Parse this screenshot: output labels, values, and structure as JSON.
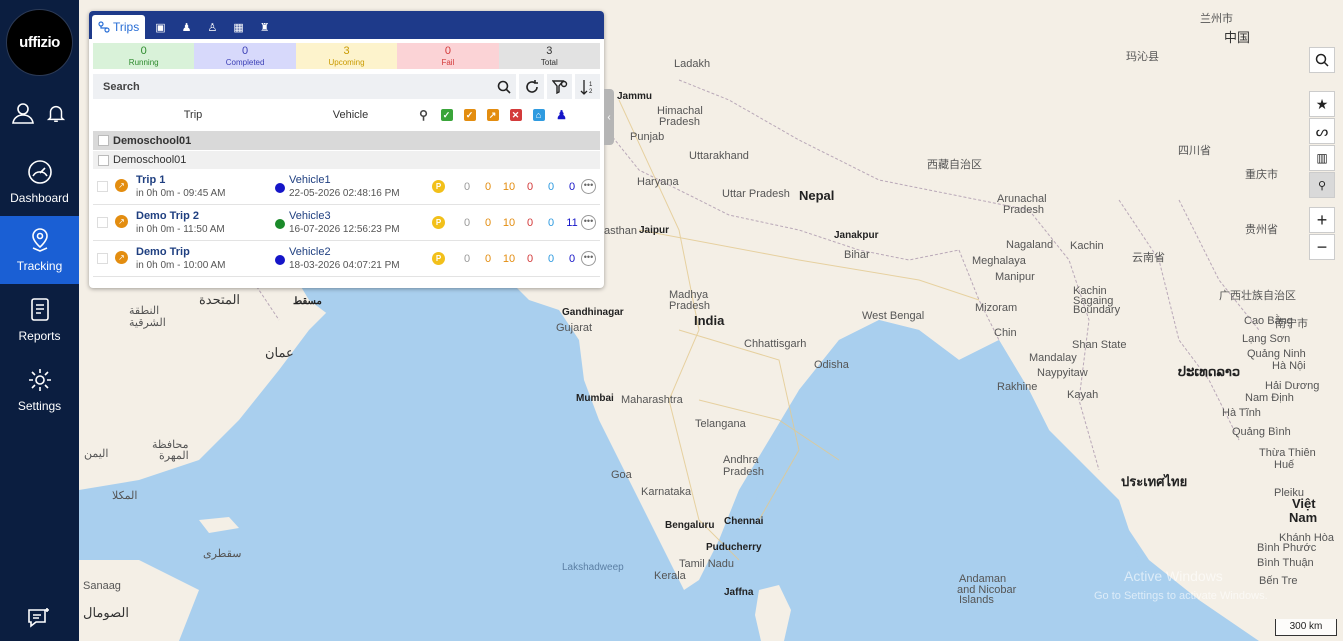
{
  "app": {
    "logo_text": "uffizio"
  },
  "sidebar": {
    "nav": [
      {
        "label": "Dashboard",
        "icon": "dashboard-gauge-icon",
        "active": false
      },
      {
        "label": "Tracking",
        "icon": "location-pin-icon",
        "active": true
      },
      {
        "label": "Reports",
        "icon": "reports-icon",
        "active": false
      },
      {
        "label": "Settings",
        "icon": "gear-icon",
        "active": false
      }
    ]
  },
  "panel": {
    "tabs": {
      "active_label": "Trips"
    },
    "stats": [
      {
        "value": "0",
        "label": "Running",
        "bg": "#d9f2d9",
        "color": "#2e8b2e"
      },
      {
        "value": "0",
        "label": "Completed",
        "bg": "#d7d9fb",
        "color": "#3b3fb5"
      },
      {
        "value": "3",
        "label": "Upcoming",
        "bg": "#fdf3cc",
        "color": "#c99a00"
      },
      {
        "value": "0",
        "label": "Fail",
        "bg": "#fbd3d6",
        "color": "#d33a3a"
      },
      {
        "value": "3",
        "label": "Total",
        "bg": "#e2e2e2",
        "color": "#333333"
      }
    ],
    "search": {
      "placeholder": "Search"
    },
    "columns": {
      "trip": "Trip",
      "vehicle": "Vehicle"
    },
    "groups": {
      "primary": "Demoschool01",
      "secondary": "Demoschool01"
    },
    "trips": [
      {
        "name": "Trip 1",
        "time": "in 0h 0m - 09:45 AM",
        "vehicle": "Vehicle1",
        "vehicle_time": "22-05-2026 02:48:16 PM",
        "vehicle_color": "#1515c8",
        "counts": [
          "0",
          "0",
          "10",
          "0",
          "0",
          "0"
        ]
      },
      {
        "name": "Demo Trip 2",
        "time": "in 0h 0m - 11:50 AM",
        "vehicle": "Vehicle3",
        "vehicle_time": "16-07-2026 12:56:23 PM",
        "vehicle_color": "#1a8a2a",
        "counts": [
          "0",
          "0",
          "10",
          "0",
          "0",
          "11"
        ]
      },
      {
        "name": "Demo Trip",
        "time": "in 0h 0m - 10:00 AM",
        "vehicle": "Vehicle2",
        "vehicle_time": "18-03-2026 04:07:21 PM",
        "vehicle_color": "#1515c8",
        "counts": [
          "0",
          "0",
          "10",
          "0",
          "0",
          "0"
        ]
      }
    ],
    "count_colors": [
      "#9a9a9a",
      "#e38d10",
      "#e38d10",
      "#d33a3a",
      "#2f9be0",
      "#1515c8"
    ]
  },
  "map": {
    "labels": [
      {
        "t": "Nepal",
        "c": "big"
      },
      {
        "t": "India",
        "c": "big"
      },
      {
        "t": "Jammu",
        "c": "city"
      },
      {
        "t": "Ladakh",
        "c": ""
      },
      {
        "t": "Himachal",
        "c": ""
      },
      {
        "t": "Pradesh",
        "c": ""
      },
      {
        "t": "Punjab",
        "c": ""
      },
      {
        "t": "Uttarakhand",
        "c": ""
      },
      {
        "t": "Haryana",
        "c": ""
      },
      {
        "t": "Uttar Pradesh",
        "c": ""
      },
      {
        "t": "Jaipur",
        "c": "city"
      },
      {
        "t": "asthan",
        "c": ""
      },
      {
        "t": "Janakpur",
        "c": "city"
      },
      {
        "t": "Bihar",
        "c": ""
      },
      {
        "t": "Madhya",
        "c": ""
      },
      {
        "t": "Pradesh",
        "c": ""
      },
      {
        "t": "Gandhinagar",
        "c": "city"
      },
      {
        "t": "Gujarat",
        "c": ""
      },
      {
        "t": "Chhattisgarh",
        "c": ""
      },
      {
        "t": "West Bengal",
        "c": ""
      },
      {
        "t": "Odisha",
        "c": ""
      },
      {
        "t": "Mumbai",
        "c": "city"
      },
      {
        "t": "Maharashtra",
        "c": ""
      },
      {
        "t": "Telangana",
        "c": ""
      },
      {
        "t": "Andhra",
        "c": ""
      },
      {
        "t": "Pradesh",
        "c": ""
      },
      {
        "t": "Goa",
        "c": ""
      },
      {
        "t": "Karnataka",
        "c": ""
      },
      {
        "t": "Bengaluru",
        "c": "city"
      },
      {
        "t": "Chennai",
        "c": "city"
      },
      {
        "t": "Puducherry",
        "c": "city"
      },
      {
        "t": "Tamil Nadu",
        "c": ""
      },
      {
        "t": "Kerala",
        "c": ""
      },
      {
        "t": "Lakshadweep",
        "c": ""
      },
      {
        "t": "Jaffna",
        "c": "city"
      },
      {
        "t": "Arunachal",
        "c": ""
      },
      {
        "t": "Pradesh",
        "c": ""
      },
      {
        "t": "Meghalaya",
        "c": ""
      },
      {
        "t": "Nagaland",
        "c": ""
      },
      {
        "t": "Manipur",
        "c": ""
      },
      {
        "t": "Kachin",
        "c": ""
      },
      {
        "t": "Mizoram",
        "c": ""
      },
      {
        "t": "Chin",
        "c": ""
      },
      {
        "t": "Shan State",
        "c": ""
      },
      {
        "t": "Mandalay",
        "c": ""
      },
      {
        "t": "Naypyitaw",
        "c": ""
      },
      {
        "t": "Rakhine",
        "c": ""
      },
      {
        "t": "Kayah",
        "c": ""
      },
      {
        "t": "Kachin",
        "c": ""
      },
      {
        "t": "Sagaing",
        "c": ""
      },
      {
        "t": "Boundary",
        "c": ""
      },
      {
        "t": "中国",
        "c": "country"
      },
      {
        "t": "Cao Bằng",
        "c": ""
      },
      {
        "t": "Nam Định",
        "c": ""
      },
      {
        "t": "Lạng Sơn",
        "c": ""
      },
      {
        "t": "Quảng Ninh",
        "c": ""
      },
      {
        "t": "Hà Tĩnh",
        "c": ""
      },
      {
        "t": "Quảng Bình",
        "c": ""
      },
      {
        "t": "Thừa Thiên",
        "c": ""
      },
      {
        "t": "Huế",
        "c": ""
      },
      {
        "t": "Việt",
        "c": "big"
      },
      {
        "t": "Nam",
        "c": "big"
      },
      {
        "t": "Khánh Hòa",
        "c": ""
      },
      {
        "t": "Bình Phước",
        "c": ""
      },
      {
        "t": "Bình Thuận",
        "c": ""
      },
      {
        "t": "Bến Tre",
        "c": ""
      },
      {
        "t": "Andaman",
        "c": ""
      },
      {
        "t": "and Nicobar",
        "c": ""
      },
      {
        "t": "Islands",
        "c": ""
      },
      {
        "t": "ประเทศไทย",
        "c": "big"
      },
      {
        "t": "ປະເທດລາວ",
        "c": "big"
      },
      {
        "t": "Hải Dương",
        "c": ""
      },
      {
        "t": "Sanaag",
        "c": ""
      },
      {
        "t": "الصومال",
        "c": "country"
      },
      {
        "t": "اليمن",
        "c": ""
      },
      {
        "t": "عمان",
        "c": "country"
      },
      {
        "t": "مسقط",
        "c": "city"
      },
      {
        "t": "المتحدة",
        "c": "country"
      },
      {
        "t": "المكلا",
        "c": ""
      },
      {
        "t": "سقطرى",
        "c": ""
      },
      {
        "t": "النطقة",
        "c": ""
      },
      {
        "t": "الشرقية",
        "c": ""
      },
      {
        "t": "محافظة",
        "c": ""
      },
      {
        "t": "المهرة",
        "c": ""
      },
      {
        "t": "兰州市",
        "c": ""
      },
      {
        "t": "玛沁县",
        "c": ""
      },
      {
        "t": "四川省",
        "c": ""
      },
      {
        "t": "西藏自治区",
        "c": ""
      },
      {
        "t": "重庆市",
        "c": ""
      },
      {
        "t": "云南省",
        "c": ""
      },
      {
        "t": "贵州省",
        "c": ""
      },
      {
        "t": "广西壮族自治区",
        "c": ""
      },
      {
        "t": "南宁市",
        "c": ""
      },
      {
        "t": "Hà Nội",
        "c": ""
      },
      {
        "t": "Pleiku",
        "c": ""
      },
      {
        "t": "Active Windows",
        "c": "water"
      },
      {
        "t": "Go to Settings to activate Windows.",
        "c": "water"
      }
    ],
    "scale_label": "300 km"
  }
}
